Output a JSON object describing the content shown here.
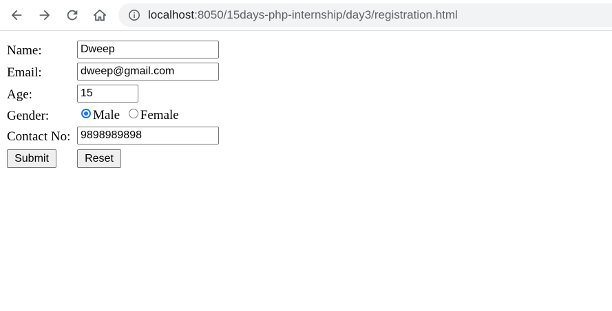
{
  "browser": {
    "back_icon": "arrow-left-icon",
    "forward_icon": "arrow-right-icon",
    "reload_icon": "reload-icon",
    "home_icon": "home-icon",
    "url_host": "localhost",
    "url_path": ":8050/15days-php-internship/day3/registration.html"
  },
  "form": {
    "name_label": "Name:",
    "name_value": "Dweep",
    "email_label": "Email:",
    "email_value": "dweep@gmail.com",
    "age_label": "Age:",
    "age_value": "15",
    "gender_label": "Gender:",
    "gender_options": [
      "Male",
      "Female"
    ],
    "gender_selected": "Male",
    "contact_label": "Contact No:",
    "contact_value": "9898989898",
    "submit_label": "Submit",
    "reset_label": "Reset"
  },
  "colors": {
    "accent": "#1a73e8",
    "omnibox_bg": "#f1f3f4"
  }
}
